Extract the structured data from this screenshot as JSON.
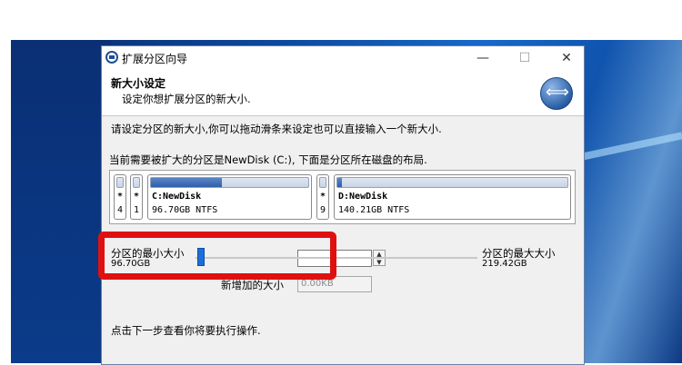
{
  "window": {
    "title": "扩展分区向导",
    "controls": {
      "minimize": "—",
      "maximize": "☐",
      "close": "✕"
    }
  },
  "header": {
    "title": "新大小设定",
    "subtitle": "设定你想扩展分区的新大小."
  },
  "instructions": {
    "line1": "请设定分区的新大小,你可以拖动滑条来设定也可以直接输入一个新大小.",
    "line2": "当前需要被扩大的分区是NewDisk (C:), 下面是分区所在磁盘的布局."
  },
  "disk_layout": {
    "partitions": [
      {
        "name": "*",
        "size": "4",
        "fill": 0
      },
      {
        "name": "*",
        "size": "1",
        "fill": 0
      },
      {
        "name": "C:NewDisk",
        "size": "96.70GB NTFS",
        "fill": 0.45
      },
      {
        "name": "*",
        "size": "9",
        "fill": 0
      },
      {
        "name": "D:NewDisk",
        "size": "140.21GB NTFS",
        "fill": 0.02
      }
    ]
  },
  "slider": {
    "min_label": "分区的最小大小",
    "min_value": "96.70GB",
    "max_label": "分区的最大大小",
    "max_value": "219.42GB",
    "position": 0
  },
  "fields": {
    "new_size_value": "",
    "added_size_label": "新增加的大小",
    "added_size_value": "0.00KB"
  },
  "footer": {
    "hint": "点击下一步查看你将要执行操作."
  },
  "colors": {
    "highlight": "#e01010",
    "accent": "#1c6fd6"
  }
}
